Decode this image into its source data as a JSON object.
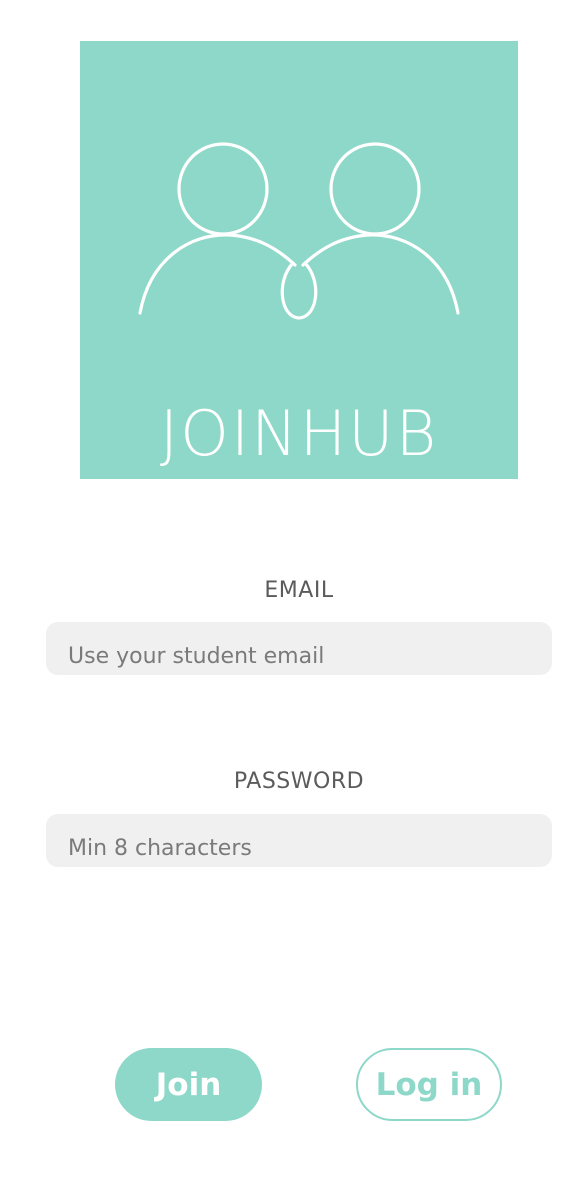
{
  "brand": {
    "name": "JOINHUB",
    "icon": "two-people-icon",
    "color": "#8ed8c9"
  },
  "form": {
    "email": {
      "label": "EMAIL",
      "placeholder": "Use your student email",
      "value": ""
    },
    "password": {
      "label": "PASSWORD",
      "placeholder": "Min 8 characters",
      "value": ""
    }
  },
  "actions": {
    "join_label": "Join",
    "login_label": "Log in"
  }
}
